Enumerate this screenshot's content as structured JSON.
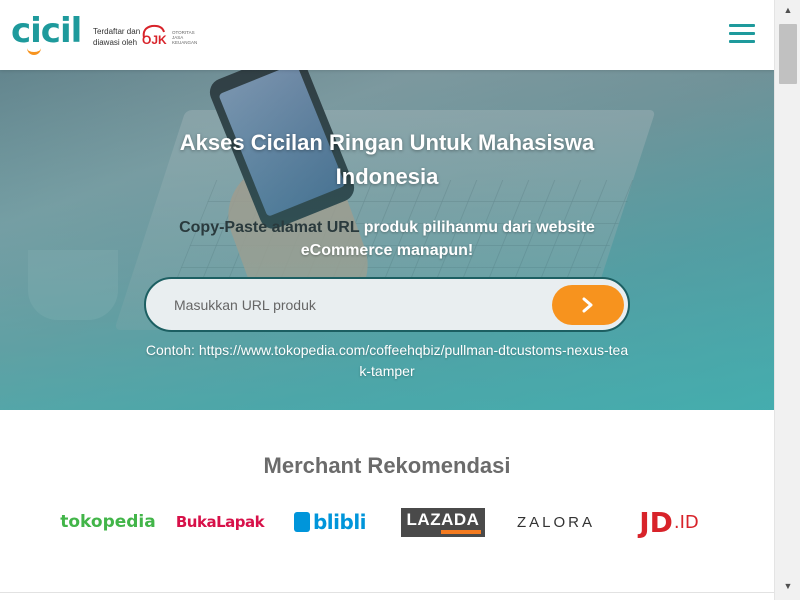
{
  "header": {
    "logo_text": "cicil",
    "regulator_line1": "Terdaftar dan",
    "regulator_line2": "diawasi oleh",
    "ojk_logo_text": "OJK",
    "ojk_subtext": "OTORITAS JASA KEUANGAN",
    "menu_icon": "hamburger-icon"
  },
  "hero": {
    "title": "Akses Cicilan Ringan Untuk Mahasiswa Indonesia",
    "subtitle_part1": "Copy-Paste alamat URL",
    "subtitle_part2": " produk pilihanmu dari website eCommerce manapun!",
    "search_placeholder": "Masukkan URL produk",
    "search_button_icon": "chevron-right-icon",
    "example_text": "Contoh: https://www.tokopedia.com/coffeehqbiz/pullman-dtcustoms-nexus-teak-tamper"
  },
  "merchants": {
    "title": "Merchant Rekomendasi",
    "items": [
      {
        "name": "tokopedia",
        "label": "tokopedia"
      },
      {
        "name": "bukalapak",
        "label": "BukaLapak"
      },
      {
        "name": "blibli",
        "label": "blibli"
      },
      {
        "name": "lazada",
        "label": "LAZADA"
      },
      {
        "name": "zalora",
        "label": "ZALORA"
      },
      {
        "name": "jd",
        "label": "JD",
        "suffix": ".ID"
      }
    ]
  },
  "colors": {
    "brand_teal": "#1e9a9c",
    "accent_orange": "#f7931e",
    "tokopedia_green": "#42b549",
    "bukalapak_red": "#d71149",
    "blibli_blue": "#0095da",
    "jd_red": "#d8232a"
  }
}
